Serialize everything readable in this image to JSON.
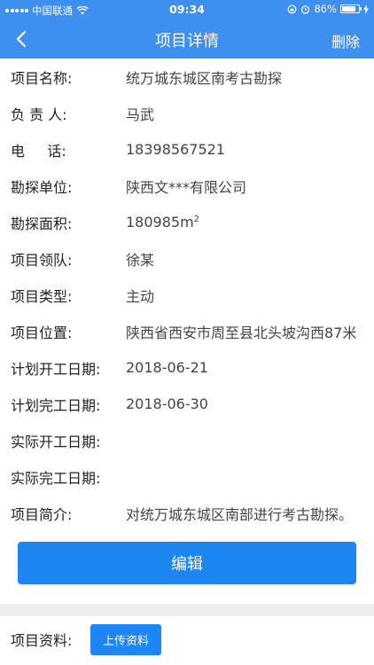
{
  "status": {
    "carrier": "中国联通",
    "time": "09:34",
    "battery": "86%",
    "battery_level": 0.86
  },
  "nav": {
    "title": "项目详情",
    "delete_label": "删除"
  },
  "details": {
    "name_label": "项目名称:",
    "name_value": "统万城东城区南考古勘探",
    "leader_label": "负 责 人:",
    "leader_value": "马武",
    "phone_label": "电     话:",
    "phone_value": "18398567521",
    "unit_label": "勘探单位:",
    "unit_value": "陕西文***有限公司",
    "area_label": "勘探面积:",
    "area_value": "180985m",
    "area_sup": "2",
    "team_label": "项目领队:",
    "team_value": "徐某",
    "type_label": "项目类型:",
    "type_value": "主动",
    "location_label": "项目位置:",
    "location_value": "陕西省西安市周至县北头坡沟西87米",
    "plan_start_label": "计划开工日期:",
    "plan_start_value": "2018-06-21",
    "plan_end_label": "计划完工日期:",
    "plan_end_value": "2018-06-30",
    "actual_start_label": "实际开工日期:",
    "actual_start_value": "",
    "actual_end_label": "实际完工日期:",
    "actual_end_value": "",
    "intro_label": "项目简介:",
    "intro_value": "对统万城东城区南部进行考古勘探。"
  },
  "edit_label": "编辑",
  "materials": {
    "label": "项目资料:",
    "upload_label": "上传资料"
  }
}
